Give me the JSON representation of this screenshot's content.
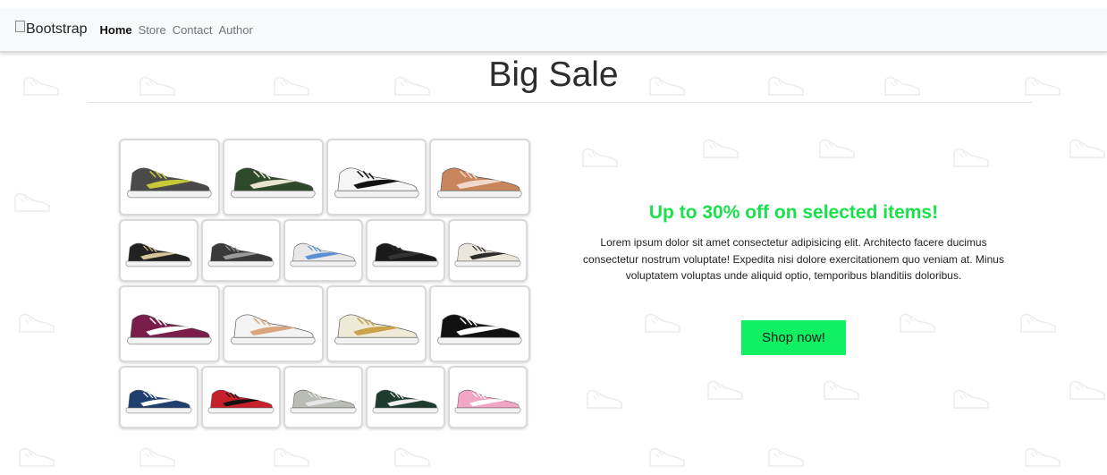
{
  "navbar": {
    "brand_alt": "Bootstrap",
    "links": [
      {
        "label": "Home",
        "active": true
      },
      {
        "label": "Store",
        "active": false
      },
      {
        "label": "Contact",
        "active": false
      },
      {
        "label": "Author",
        "active": false
      }
    ]
  },
  "page_title": "Big Sale",
  "products": {
    "row1": [
      {
        "icon": "sneaker-grey-yellow-icon",
        "colors": [
          "#4a4a4a",
          "#c7c93a"
        ]
      },
      {
        "icon": "sneaker-green-icon",
        "colors": [
          "#2e4a2a",
          "#e9e4cf"
        ]
      },
      {
        "icon": "sneaker-white-adidas-icon",
        "colors": [
          "#f5f5f5",
          "#111111"
        ]
      },
      {
        "icon": "sneaker-high-brown-icon",
        "colors": [
          "#c9865c",
          "#f0d8cc"
        ]
      }
    ],
    "row2": [
      {
        "icon": "sneaker-checkered-icon",
        "colors": [
          "#222222",
          "#d9c39a"
        ]
      },
      {
        "icon": "sneaker-grey-dunk-icon",
        "colors": [
          "#3a3a3a",
          "#9a9a9a"
        ]
      },
      {
        "icon": "sneaker-blue-white-icon",
        "colors": [
          "#e8e8e8",
          "#5b8fd6"
        ]
      },
      {
        "icon": "sneaker-black-airmax-icon",
        "colors": [
          "#1a1a1a",
          "#333333"
        ]
      },
      {
        "icon": "sneaker-cream-icon",
        "colors": [
          "#eae6dc",
          "#2b2b2b"
        ]
      }
    ],
    "row3": [
      {
        "icon": "sneaker-maroon-icon",
        "colors": [
          "#7a1d4b",
          "#ffffff"
        ]
      },
      {
        "icon": "sneaker-peach-airmax-icon",
        "colors": [
          "#f3f3f3",
          "#d9a57f"
        ]
      },
      {
        "icon": "sneaker-gold-icon",
        "colors": [
          "#efe9d8",
          "#c9a24a"
        ]
      },
      {
        "icon": "sneaker-black-white-icon",
        "colors": [
          "#111111",
          "#ffffff"
        ]
      }
    ],
    "row4": [
      {
        "icon": "sneaker-navy-dunk-icon",
        "colors": [
          "#1f3f6e",
          "#ffffff"
        ]
      },
      {
        "icon": "sneaker-red-black-icon",
        "colors": [
          "#c8202a",
          "#111111"
        ]
      },
      {
        "icon": "sneaker-grey-nb-icon",
        "colors": [
          "#b9bdb6",
          "#e6e6e6"
        ]
      },
      {
        "icon": "sneaker-green-black-icon",
        "colors": [
          "#1e3b30",
          "#f0f0f0"
        ]
      },
      {
        "icon": "sneaker-pink-icon",
        "colors": [
          "#f2a6c6",
          "#ffffff"
        ]
      }
    ]
  },
  "promo": {
    "heading": "Up to 30% off on selected items!",
    "text": "Lorem ipsum dolor sit amet consectetur adipisicing elit. Architecto facere ducimus consectetur nostrum voluptate! Expedita nisi dolore exercitationem quo veniam at. Minus voluptatem voluptas unde aliquid optio, temporibus blanditiis doloribus.",
    "button_label": "Shop now!"
  },
  "colors": {
    "accent_green": "#19e04b",
    "button_green": "#10f062",
    "navbar_bg": "#f8f9fa"
  }
}
